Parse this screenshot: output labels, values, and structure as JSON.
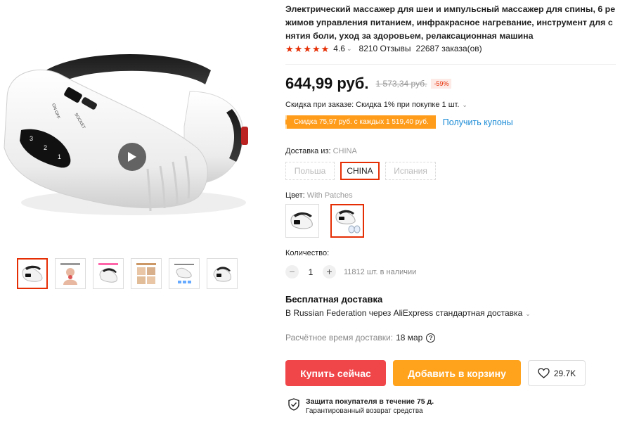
{
  "product": {
    "title": "Электрический массажер для шеи и импульсный массажер для спины, 6 режимов управления питанием, инфракрасное нагревание, инструмент для снятия боли, уход за здоровьем, релаксационная машина",
    "rating": "4.6",
    "reviews": "8210 Отзывы",
    "orders": "22687 заказа(ов)"
  },
  "price": {
    "current": "644,99 руб.",
    "original": "1 573,34 руб.",
    "discount": "-59%"
  },
  "order_discount": "Скидка при заказе: Скидка 1% при покупке 1 шт.",
  "coupon": {
    "banner": "Скидка 75,97 руб. с каждых 1 519,40 руб.",
    "link": "Получить купоны"
  },
  "shipping_from": {
    "label": "Доставка из:",
    "selected": "CHINA",
    "options": [
      "Польша",
      "CHINA",
      "Испания"
    ]
  },
  "color": {
    "label": "Цвет:",
    "selected": "With Patches"
  },
  "quantity": {
    "label": "Количество:",
    "value": "1",
    "minus": "−",
    "plus": "+",
    "stock": "11812 шт. в наличии"
  },
  "delivery": {
    "free_title": "Бесплатная доставка",
    "description": "В Russian Federation через AliExpress стандартная доставка",
    "time_label": "Расчётное время доставки:",
    "time_value": "18 мар",
    "help": "?"
  },
  "buttons": {
    "buy": "Купить сейчас",
    "cart": "Добавить в корзину",
    "wishlist": "29.7K"
  },
  "protection": {
    "title": "Защита покупателя в течение 75 д.",
    "subtitle": "Гарантированный возврат средства"
  },
  "device_labels": {
    "on_off": "ON OFF",
    "socket": "SOCKET",
    "modes": [
      "3",
      "2",
      "1"
    ]
  },
  "icons": {
    "star": "star-icon",
    "play": "play-icon",
    "heart": "heart-icon",
    "shield": "shield-check-icon",
    "chevron": "chevron-down-icon"
  },
  "colors": {
    "accent": "#e62e04",
    "buy": "#f0464a",
    "cart": "#ffa21c",
    "coupon": "#ff9c1a",
    "link": "#1a8bd6"
  }
}
